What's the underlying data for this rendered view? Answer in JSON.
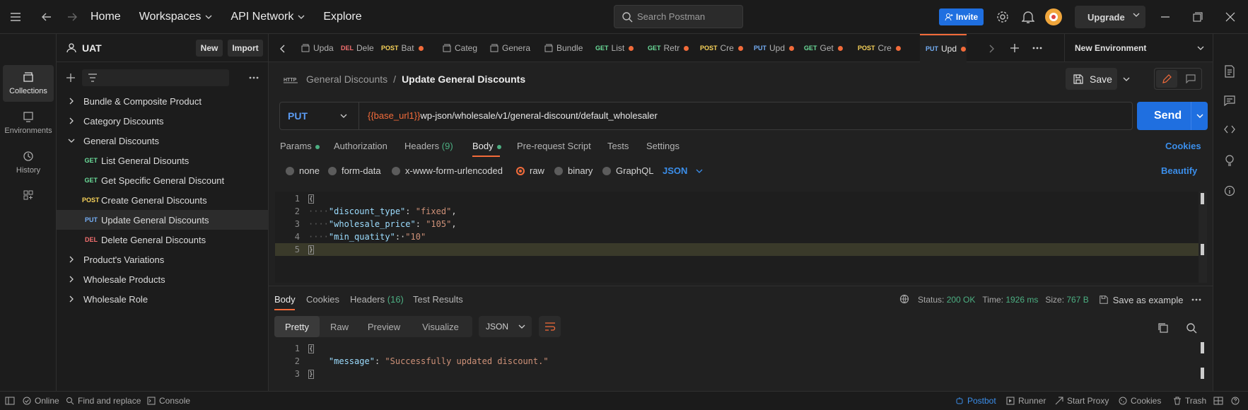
{
  "topbar": {
    "nav": [
      "Home",
      "Workspaces",
      "API Network",
      "Explore"
    ],
    "search_placeholder": "Search Postman",
    "invite_label": "Invite",
    "upgrade_label": "Upgrade"
  },
  "rail": [
    {
      "label": "Collections",
      "icon": "collections-icon"
    },
    {
      "label": "Environments",
      "icon": "environments-icon"
    },
    {
      "label": "History",
      "icon": "history-icon"
    },
    {
      "label": "",
      "icon": "apps-icon"
    }
  ],
  "sidebar": {
    "workspace": "UAT",
    "new_label": "New",
    "import_label": "Import",
    "tree": [
      {
        "label": "Bundle & Composite Product",
        "type": "folder",
        "open": false
      },
      {
        "label": "Category Discounts",
        "type": "folder",
        "open": false
      },
      {
        "label": "General Discounts",
        "type": "folder",
        "open": true
      },
      {
        "label": "List General Disounts",
        "type": "request",
        "method": "GET"
      },
      {
        "label": "Get Specific General Discount",
        "type": "request",
        "method": "GET"
      },
      {
        "label": "Create General Discounts",
        "type": "request",
        "method": "POST"
      },
      {
        "label": "Update General Discounts",
        "type": "request",
        "method": "PUT",
        "selected": true
      },
      {
        "label": "Delete General Discounts",
        "type": "request",
        "method": "DEL"
      },
      {
        "label": "Product's Variations",
        "type": "folder",
        "open": false
      },
      {
        "label": "Wholesale Products",
        "type": "folder",
        "open": false
      },
      {
        "label": "Wholesale Role",
        "type": "folder",
        "open": false
      }
    ]
  },
  "tabs": [
    {
      "method": "",
      "label": "Upda",
      "icon": "request-icon",
      "dot": false
    },
    {
      "method": "DEL",
      "label": "Dele",
      "dot": true
    },
    {
      "method": "POST",
      "label": "Bat",
      "dot": true
    },
    {
      "method": "",
      "label": "Categ",
      "icon": "folder-icon",
      "dot": false
    },
    {
      "method": "",
      "label": "Genera",
      "icon": "folder-icon",
      "dot": false
    },
    {
      "method": "",
      "label": "Bundle",
      "icon": "folder-icon",
      "dot": false
    },
    {
      "method": "GET",
      "label": "List",
      "dot": true
    },
    {
      "method": "GET",
      "label": "Retr",
      "dot": true
    },
    {
      "method": "POST",
      "label": "Cre",
      "dot": true
    },
    {
      "method": "PUT",
      "label": "Upd",
      "dot": true
    },
    {
      "method": "GET",
      "label": "Get",
      "dot": true
    },
    {
      "method": "POST",
      "label": "Cre",
      "dot": true
    },
    {
      "method": "PUT",
      "label": "Upd",
      "dot": true,
      "active": true
    }
  ],
  "environment": "New Environment",
  "request": {
    "breadcrumb_parent": "General Discounts",
    "breadcrumb_sep": "/",
    "title": "Update General Discounts",
    "save_label": "Save",
    "method": "PUT",
    "url_var": "{{base_url1}}",
    "url_path": "wp-json/wholesale/v1/general-discount/default_wholesaler",
    "send_label": "Send",
    "tabs": [
      "Params",
      "Authorization",
      "Headers",
      "Body",
      "Pre-request Script",
      "Tests",
      "Settings"
    ],
    "headers_count": "(9)",
    "cookies_label": "Cookies",
    "body_types": [
      "none",
      "form-data",
      "x-www-form-urlencoded",
      "raw",
      "binary",
      "GraphQL"
    ],
    "body_format": "JSON",
    "beautify_label": "Beautify",
    "body_lines": [
      {
        "n": "1",
        "parts": [
          {
            "t": "{",
            "c": "br"
          }
        ]
      },
      {
        "n": "2",
        "parts": [
          {
            "t": "····",
            "c": "ws"
          },
          {
            "t": "\"discount_type\"",
            "c": "k"
          },
          {
            "t": ": ",
            "c": "p"
          },
          {
            "t": "\"fixed\"",
            "c": "s"
          },
          {
            "t": ",",
            "c": "p"
          }
        ]
      },
      {
        "n": "3",
        "parts": [
          {
            "t": "····",
            "c": "ws"
          },
          {
            "t": "\"wholesale_price\"",
            "c": "k"
          },
          {
            "t": ": ",
            "c": "p"
          },
          {
            "t": "\"105\"",
            "c": "s"
          },
          {
            "t": ",",
            "c": "p"
          }
        ]
      },
      {
        "n": "4",
        "parts": [
          {
            "t": "····",
            "c": "ws"
          },
          {
            "t": "\"min_quatity\"",
            "c": "k"
          },
          {
            "t": ":·",
            "c": "p"
          },
          {
            "t": "\"10\"",
            "c": "s"
          }
        ]
      },
      {
        "n": "5",
        "parts": [
          {
            "t": "}",
            "c": "br"
          }
        ]
      }
    ]
  },
  "response": {
    "tabs": [
      "Body",
      "Cookies",
      "Headers",
      "Test Results"
    ],
    "headers_count": "(16)",
    "status_label": "Status:",
    "status_value": "200 OK",
    "time_label": "Time:",
    "time_value": "1926 ms",
    "size_label": "Size:",
    "size_value": "767 B",
    "save_example_label": "Save as example",
    "views": [
      "Pretty",
      "Raw",
      "Preview",
      "Visualize"
    ],
    "format": "JSON",
    "body_lines": [
      {
        "n": "1",
        "parts": [
          {
            "t": "{",
            "c": "br"
          }
        ]
      },
      {
        "n": "2",
        "parts": [
          {
            "t": "    ",
            "c": "ws"
          },
          {
            "t": "\"message\"",
            "c": "k"
          },
          {
            "t": ": ",
            "c": "p"
          },
          {
            "t": "\"Successfully updated discount.\"",
            "c": "s"
          }
        ]
      },
      {
        "n": "3",
        "parts": [
          {
            "t": "}",
            "c": "br"
          }
        ]
      }
    ]
  },
  "statusbar": {
    "left": [
      "Online",
      "Find and replace",
      "Console"
    ],
    "right": [
      "Postbot",
      "Runner",
      "Start Proxy",
      "Cookies",
      "Trash"
    ]
  },
  "colors": {
    "accent": "#f26b3a",
    "primary": "#1f6fe0",
    "get": "#6bdd9a",
    "post": "#f8d35a",
    "put": "#74aef6",
    "del": "#f36f6f",
    "status_ok": "#6bdd9a"
  }
}
